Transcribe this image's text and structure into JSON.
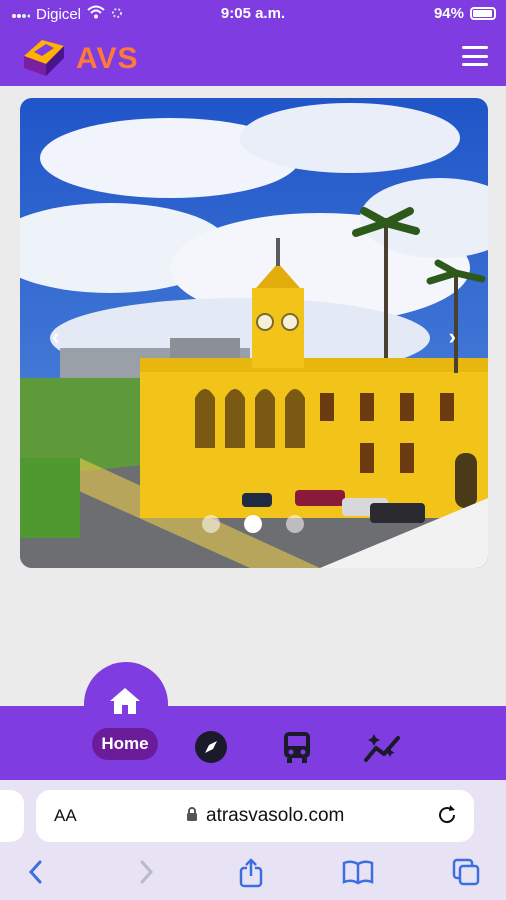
{
  "status": {
    "carrier": "Digicel",
    "time": "9:05 a.m.",
    "battery": "94%"
  },
  "app": {
    "logo_text": "AVS",
    "colors": {
      "primary": "#7f3ce0",
      "accent": "#ff7a3a",
      "pill": "#6a1c9a"
    }
  },
  "carousel": {
    "slide_count": 3,
    "active_index": 1,
    "prev_icon": "chevron-left-icon",
    "next_icon": "chevron-right-icon"
  },
  "bottom_nav": {
    "items": [
      {
        "label": "Home",
        "icon": "home-icon",
        "active": true
      },
      {
        "label": "",
        "icon": "compass-icon",
        "active": false
      },
      {
        "label": "",
        "icon": "bus-icon",
        "active": false
      },
      {
        "label": "",
        "icon": "sparkle-trend-icon",
        "active": false
      }
    ]
  },
  "browser": {
    "text_size_label": "AA",
    "domain": "atrasvasolo.com",
    "toolbar_icons": [
      "back-icon",
      "forward-icon",
      "share-icon",
      "bookmarks-icon",
      "tabs-icon"
    ]
  }
}
